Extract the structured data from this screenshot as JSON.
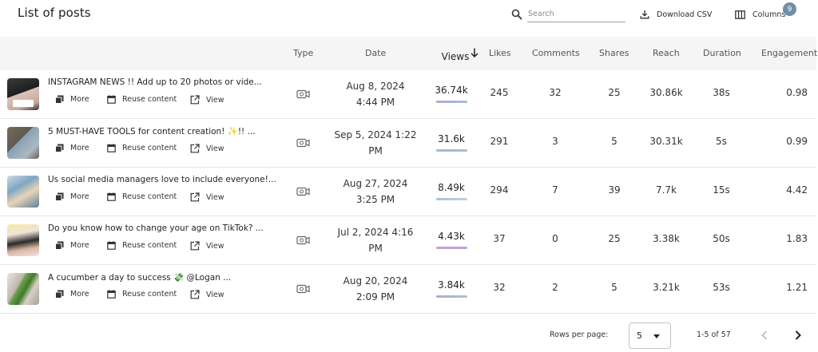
{
  "page": {
    "title": "List of posts"
  },
  "toolbar": {
    "search_placeholder": "Search",
    "download_label": "Download CSV",
    "columns_label": "Columns",
    "columns_badge": "9"
  },
  "table": {
    "columns": [
      "Type",
      "Date",
      "Views",
      "Likes",
      "Comments",
      "Shares",
      "Reach",
      "Duration",
      "Engagement"
    ],
    "sort": {
      "column": "Views",
      "direction": "descending"
    },
    "action_labels": {
      "more": "More",
      "reuse": "Reuse content",
      "view": "View"
    },
    "rows": [
      {
        "title": "INSTAGRAM NEWS !! Add up to 20 photos or vide...",
        "type": "video",
        "date_line1": "Aug 8, 2024",
        "date_line2": "4:44 PM",
        "views": "36.74k",
        "likes": "245",
        "comments": "32",
        "shares": "25",
        "reach": "30.86k",
        "duration": "38s",
        "engagement": "0.98"
      },
      {
        "title": "5 MUST-HAVE TOOLS for content creation! ✨!! ...",
        "type": "video",
        "date_line1": "Sep 5, 2024 1:22",
        "date_line2": "PM",
        "views": "31.6k",
        "likes": "291",
        "comments": "3",
        "shares": "5",
        "reach": "30.31k",
        "duration": "5s",
        "engagement": "0.99"
      },
      {
        "title": "Us social media managers love to include everyone!...",
        "type": "video",
        "date_line1": "Aug 27, 2024",
        "date_line2": "3:25 PM",
        "views": "8.49k",
        "likes": "294",
        "comments": "7",
        "shares": "39",
        "reach": "7.7k",
        "duration": "15s",
        "engagement": "4.42"
      },
      {
        "title": "Do you know how to change your age on TikTok? ...",
        "type": "video",
        "date_line1": "Jul 2, 2024 4:16",
        "date_line2": "PM",
        "views": "4.43k",
        "likes": "37",
        "comments": "0",
        "shares": "25",
        "reach": "3.38k",
        "duration": "50s",
        "engagement": "1.83"
      },
      {
        "title": "A cucumber a day to success 💸 @Logan  ...",
        "type": "video",
        "date_line1": "Aug 20, 2024",
        "date_line2": "2:09 PM",
        "views": "3.84k",
        "likes": "32",
        "comments": "2",
        "shares": "5",
        "reach": "3.21k",
        "duration": "53s",
        "engagement": "1.21"
      }
    ]
  },
  "pagination": {
    "rows_per_page_label": "Rows per page:",
    "rows_per_page_value": "5",
    "range_label": "1-5 of 57"
  },
  "colors": {
    "header_bg": "#f5f5f5",
    "badge": "#6f8fa6",
    "views_bar_gradient": [
      "#b9a3d6",
      "#9cc3d6"
    ]
  }
}
